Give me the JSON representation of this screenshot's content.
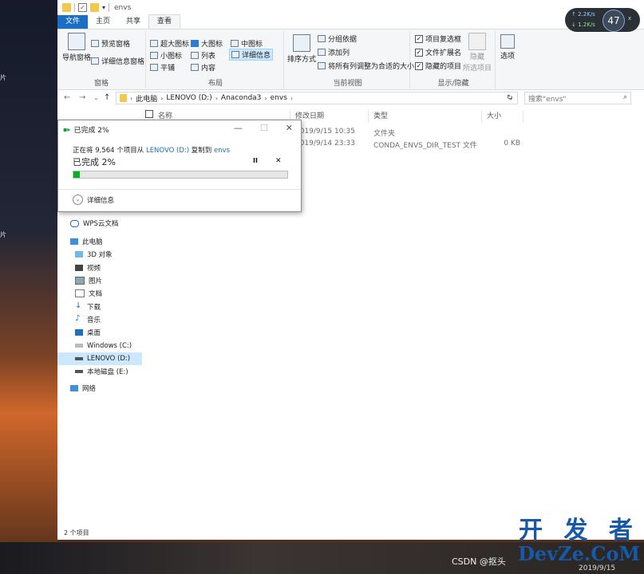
{
  "desktop": {
    "left_label_top": "片",
    "left_label_mid": "片"
  },
  "window": {
    "title": "envs"
  },
  "tabs": [
    "文件",
    "主页",
    "共享",
    "查看"
  ],
  "ribbon": {
    "pane": {
      "nav_pane": "导航窗格",
      "preview_pane": "预览窗格",
      "details_pane": "详细信息窗格",
      "label": "窗格"
    },
    "layout": {
      "items": [
        "超大图标",
        "大图标",
        "中图标",
        "小图标",
        "列表",
        "详细信息",
        "平铺",
        "内容"
      ],
      "label": "布局"
    },
    "current_view": {
      "sort_by": "排序方式",
      "group_by": "分组依据",
      "add_columns": "添加列",
      "size_all": "将所有列调整为合适的大小",
      "label": "当前视图"
    },
    "show_hide": {
      "item_checkboxes": "项目复选框",
      "file_ext": "文件扩展名",
      "hidden_items": "隐藏的项目",
      "hide": "隐藏",
      "selected_items": "所选项目",
      "label": "显示/隐藏"
    },
    "options": {
      "label": "选项"
    }
  },
  "address": {
    "crumbs": [
      "此电脑",
      "LENOVO (D:)",
      "Anaconda3",
      "envs"
    ],
    "search_placeholder": "搜索\"envs\""
  },
  "columns": [
    "名称",
    "修改日期",
    "类型",
    "大小"
  ],
  "rows": [
    {
      "date": "2019/9/15 10:35",
      "type": "文件夹",
      "size": ""
    },
    {
      "date": "2019/9/14 23:33",
      "type": "CONDA_ENVS_DIR_TEST 文件",
      "size": "0 KB"
    }
  ],
  "nav": [
    "WPS云文档",
    "此电脑",
    "3D 对象",
    "视频",
    "图片",
    "文档",
    "下载",
    "音乐",
    "桌面",
    "Windows (C:)",
    "LENOVO (D:)",
    "本地磁盘 (E:)",
    "网络"
  ],
  "status": "2 个项目",
  "dialog": {
    "title": "已完成 2%",
    "line_pre": "正在将 9,564 个项目从",
    "source": "LENOVO (D:)",
    "line_mid": "复制到",
    "dest": "envs",
    "progress_label": "已完成 2%",
    "progress": 0.02,
    "pause": "II",
    "cancel": "✕",
    "more": "详细信息"
  },
  "netmon": {
    "up": "↑ 2.2K/s",
    "down": "↓ 1.2K/s",
    "cpu": "47",
    "close": "x"
  },
  "taskbar": {
    "csdn": "CSDN @抠头",
    "date": "2019/9/15"
  },
  "watermark": {
    "line1": "开 发 者",
    "line2": "DevZe.CoM"
  },
  "colors": {
    "accent": "#1a6fc4",
    "progress": "#06b025",
    "selected": "#cce8ff"
  }
}
